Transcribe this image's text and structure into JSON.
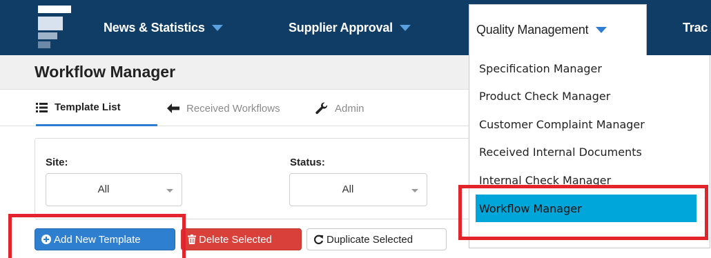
{
  "topnav": {
    "items": [
      {
        "label": "News & Statistics"
      },
      {
        "label": "Supplier Approval"
      },
      {
        "label": "Quality Management"
      },
      {
        "label": "Trac"
      }
    ]
  },
  "dropdown": {
    "items": [
      {
        "label": "Specification Manager"
      },
      {
        "label": "Product Check Manager"
      },
      {
        "label": "Customer Complaint Manager"
      },
      {
        "label": "Received Internal Documents"
      },
      {
        "label": "Internal Check Manager"
      },
      {
        "label": "Workflow Manager"
      }
    ]
  },
  "page": {
    "title": "Workflow Manager"
  },
  "tabs": [
    {
      "label": "Template List"
    },
    {
      "label": "Received Workflows"
    },
    {
      "label": "Admin"
    }
  ],
  "filters": {
    "site": {
      "label": "Site:",
      "value": "All"
    },
    "status": {
      "label": "Status:",
      "value": "All"
    }
  },
  "actions": {
    "add": "Add New Template",
    "delete": "Delete Selected",
    "duplicate": "Duplicate Selected"
  },
  "colors": {
    "nav_bg": "#0f3d66",
    "accent": "#2d7dd2",
    "menu_highlight": "#00a5d9",
    "annotation_red": "#e4242c",
    "danger": "#d9403a"
  }
}
